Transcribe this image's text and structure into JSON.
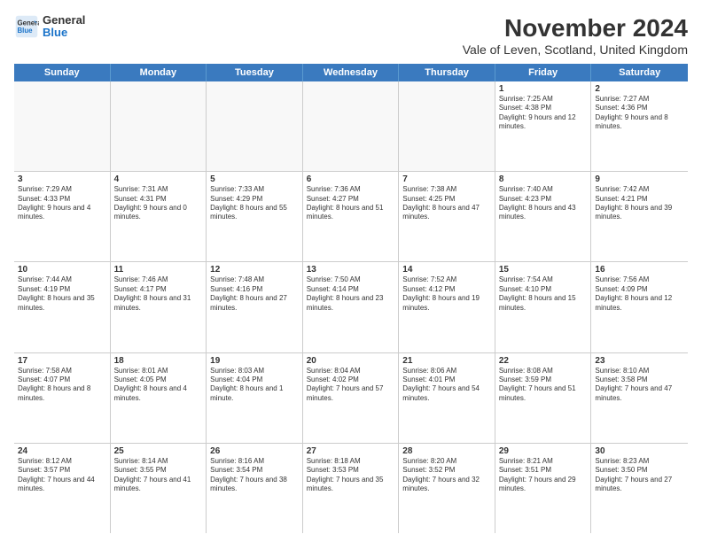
{
  "title": "November 2024",
  "subtitle": "Vale of Leven, Scotland, United Kingdom",
  "logo": {
    "line1": "General",
    "line2": "Blue"
  },
  "header_days": [
    "Sunday",
    "Monday",
    "Tuesday",
    "Wednesday",
    "Thursday",
    "Friday",
    "Saturday"
  ],
  "rows": [
    [
      {
        "day": "",
        "info": ""
      },
      {
        "day": "",
        "info": ""
      },
      {
        "day": "",
        "info": ""
      },
      {
        "day": "",
        "info": ""
      },
      {
        "day": "",
        "info": ""
      },
      {
        "day": "1",
        "info": "Sunrise: 7:25 AM\nSunset: 4:38 PM\nDaylight: 9 hours and 12 minutes."
      },
      {
        "day": "2",
        "info": "Sunrise: 7:27 AM\nSunset: 4:36 PM\nDaylight: 9 hours and 8 minutes."
      }
    ],
    [
      {
        "day": "3",
        "info": "Sunrise: 7:29 AM\nSunset: 4:33 PM\nDaylight: 9 hours and 4 minutes."
      },
      {
        "day": "4",
        "info": "Sunrise: 7:31 AM\nSunset: 4:31 PM\nDaylight: 9 hours and 0 minutes."
      },
      {
        "day": "5",
        "info": "Sunrise: 7:33 AM\nSunset: 4:29 PM\nDaylight: 8 hours and 55 minutes."
      },
      {
        "day": "6",
        "info": "Sunrise: 7:36 AM\nSunset: 4:27 PM\nDaylight: 8 hours and 51 minutes."
      },
      {
        "day": "7",
        "info": "Sunrise: 7:38 AM\nSunset: 4:25 PM\nDaylight: 8 hours and 47 minutes."
      },
      {
        "day": "8",
        "info": "Sunrise: 7:40 AM\nSunset: 4:23 PM\nDaylight: 8 hours and 43 minutes."
      },
      {
        "day": "9",
        "info": "Sunrise: 7:42 AM\nSunset: 4:21 PM\nDaylight: 8 hours and 39 minutes."
      }
    ],
    [
      {
        "day": "10",
        "info": "Sunrise: 7:44 AM\nSunset: 4:19 PM\nDaylight: 8 hours and 35 minutes."
      },
      {
        "day": "11",
        "info": "Sunrise: 7:46 AM\nSunset: 4:17 PM\nDaylight: 8 hours and 31 minutes."
      },
      {
        "day": "12",
        "info": "Sunrise: 7:48 AM\nSunset: 4:16 PM\nDaylight: 8 hours and 27 minutes."
      },
      {
        "day": "13",
        "info": "Sunrise: 7:50 AM\nSunset: 4:14 PM\nDaylight: 8 hours and 23 minutes."
      },
      {
        "day": "14",
        "info": "Sunrise: 7:52 AM\nSunset: 4:12 PM\nDaylight: 8 hours and 19 minutes."
      },
      {
        "day": "15",
        "info": "Sunrise: 7:54 AM\nSunset: 4:10 PM\nDaylight: 8 hours and 15 minutes."
      },
      {
        "day": "16",
        "info": "Sunrise: 7:56 AM\nSunset: 4:09 PM\nDaylight: 8 hours and 12 minutes."
      }
    ],
    [
      {
        "day": "17",
        "info": "Sunrise: 7:58 AM\nSunset: 4:07 PM\nDaylight: 8 hours and 8 minutes."
      },
      {
        "day": "18",
        "info": "Sunrise: 8:01 AM\nSunset: 4:05 PM\nDaylight: 8 hours and 4 minutes."
      },
      {
        "day": "19",
        "info": "Sunrise: 8:03 AM\nSunset: 4:04 PM\nDaylight: 8 hours and 1 minute."
      },
      {
        "day": "20",
        "info": "Sunrise: 8:04 AM\nSunset: 4:02 PM\nDaylight: 7 hours and 57 minutes."
      },
      {
        "day": "21",
        "info": "Sunrise: 8:06 AM\nSunset: 4:01 PM\nDaylight: 7 hours and 54 minutes."
      },
      {
        "day": "22",
        "info": "Sunrise: 8:08 AM\nSunset: 3:59 PM\nDaylight: 7 hours and 51 minutes."
      },
      {
        "day": "23",
        "info": "Sunrise: 8:10 AM\nSunset: 3:58 PM\nDaylight: 7 hours and 47 minutes."
      }
    ],
    [
      {
        "day": "24",
        "info": "Sunrise: 8:12 AM\nSunset: 3:57 PM\nDaylight: 7 hours and 44 minutes."
      },
      {
        "day": "25",
        "info": "Sunrise: 8:14 AM\nSunset: 3:55 PM\nDaylight: 7 hours and 41 minutes."
      },
      {
        "day": "26",
        "info": "Sunrise: 8:16 AM\nSunset: 3:54 PM\nDaylight: 7 hours and 38 minutes."
      },
      {
        "day": "27",
        "info": "Sunrise: 8:18 AM\nSunset: 3:53 PM\nDaylight: 7 hours and 35 minutes."
      },
      {
        "day": "28",
        "info": "Sunrise: 8:20 AM\nSunset: 3:52 PM\nDaylight: 7 hours and 32 minutes."
      },
      {
        "day": "29",
        "info": "Sunrise: 8:21 AM\nSunset: 3:51 PM\nDaylight: 7 hours and 29 minutes."
      },
      {
        "day": "30",
        "info": "Sunrise: 8:23 AM\nSunset: 3:50 PM\nDaylight: 7 hours and 27 minutes."
      }
    ]
  ]
}
